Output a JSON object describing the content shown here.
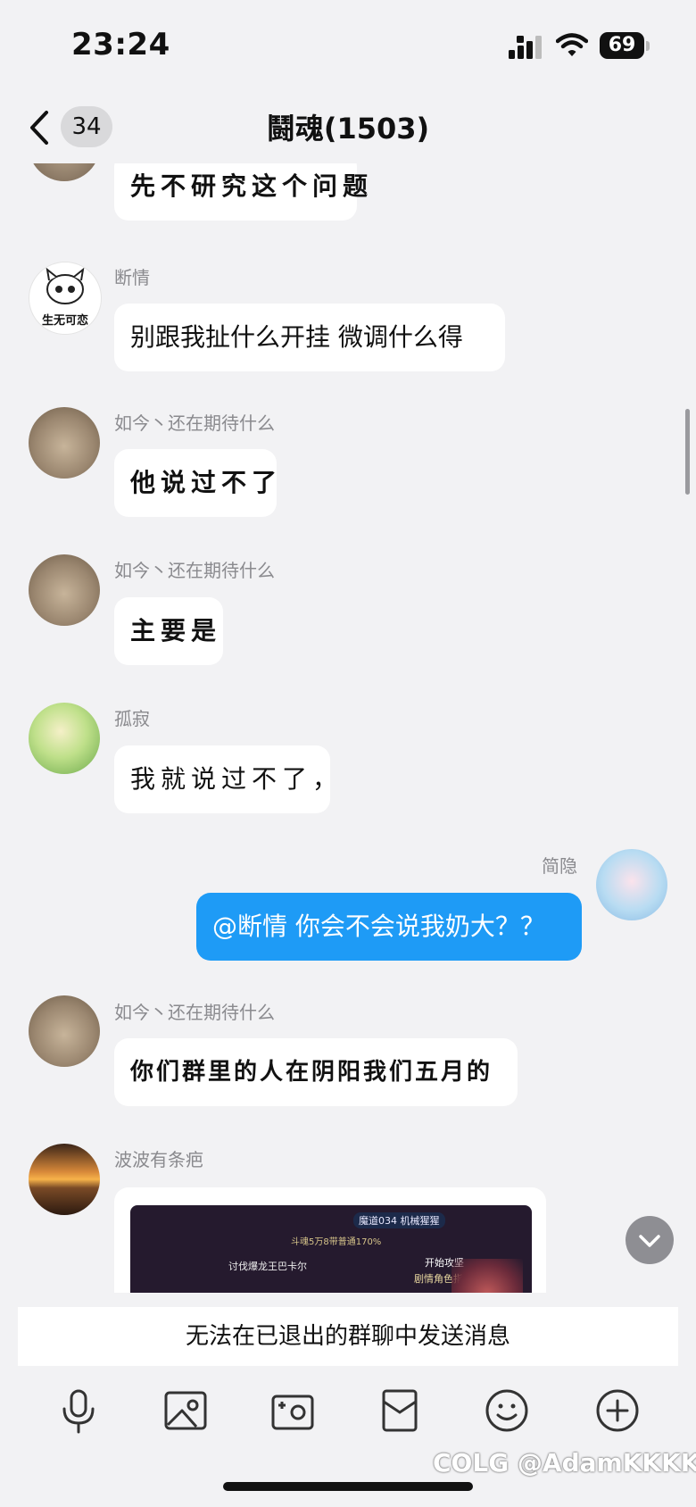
{
  "status_bar": {
    "time": "23:24",
    "battery": "69"
  },
  "header": {
    "back_label": "<",
    "unread_count": "34",
    "title": "鬪魂(1503)"
  },
  "messages": [
    {
      "sender": "",
      "text": "先不研究这个问题",
      "avatar": "cat-avatar"
    },
    {
      "sender": "断情",
      "text": "别跟我扯什么开挂 微调什么得",
      "avatar": "cartoon-cat-avatar",
      "avatar_caption": "生无可恋"
    },
    {
      "sender": "如今丶还在期待什么",
      "text": "他说过不了",
      "avatar": "cat-avatar"
    },
    {
      "sender": "如今丶还在期待什么",
      "text": "主要是",
      "avatar": "cat-avatar"
    },
    {
      "sender": "孤寂",
      "text": "我就说过不了，",
      "avatar": "girl-umbrella-avatar"
    },
    {
      "sender": "简隐",
      "text": "@断情 你会不会说我奶大？？",
      "avatar": "anime-girl-avatar",
      "self": true
    },
    {
      "sender": "如今丶还在期待什么",
      "text": "你们群里的人在阴阳我们五月的",
      "avatar": "cat-avatar"
    },
    {
      "sender": "波波有条疤",
      "type": "image",
      "avatar": "sunset-avatar",
      "image_texts": {
        "tag": "魔道034 机械猩猩",
        "dialog_title": "斗魂5万8带普通170%",
        "task": "讨伐爆龙王巴卡尔",
        "btn1": "开始攻坚",
        "btn2": "剧情角色指引"
      }
    }
  ],
  "notice": "无法在已退出的群聊中发送消息",
  "toolbar": [
    "microphone-icon",
    "image-icon",
    "camera-icon",
    "red-packet-icon",
    "emoji-icon",
    "plus-icon"
  ],
  "watermark": "COLG @AdamKKKKK",
  "colors": {
    "self_bubble": "#1e9bf6",
    "background": "#f2f2f4"
  }
}
